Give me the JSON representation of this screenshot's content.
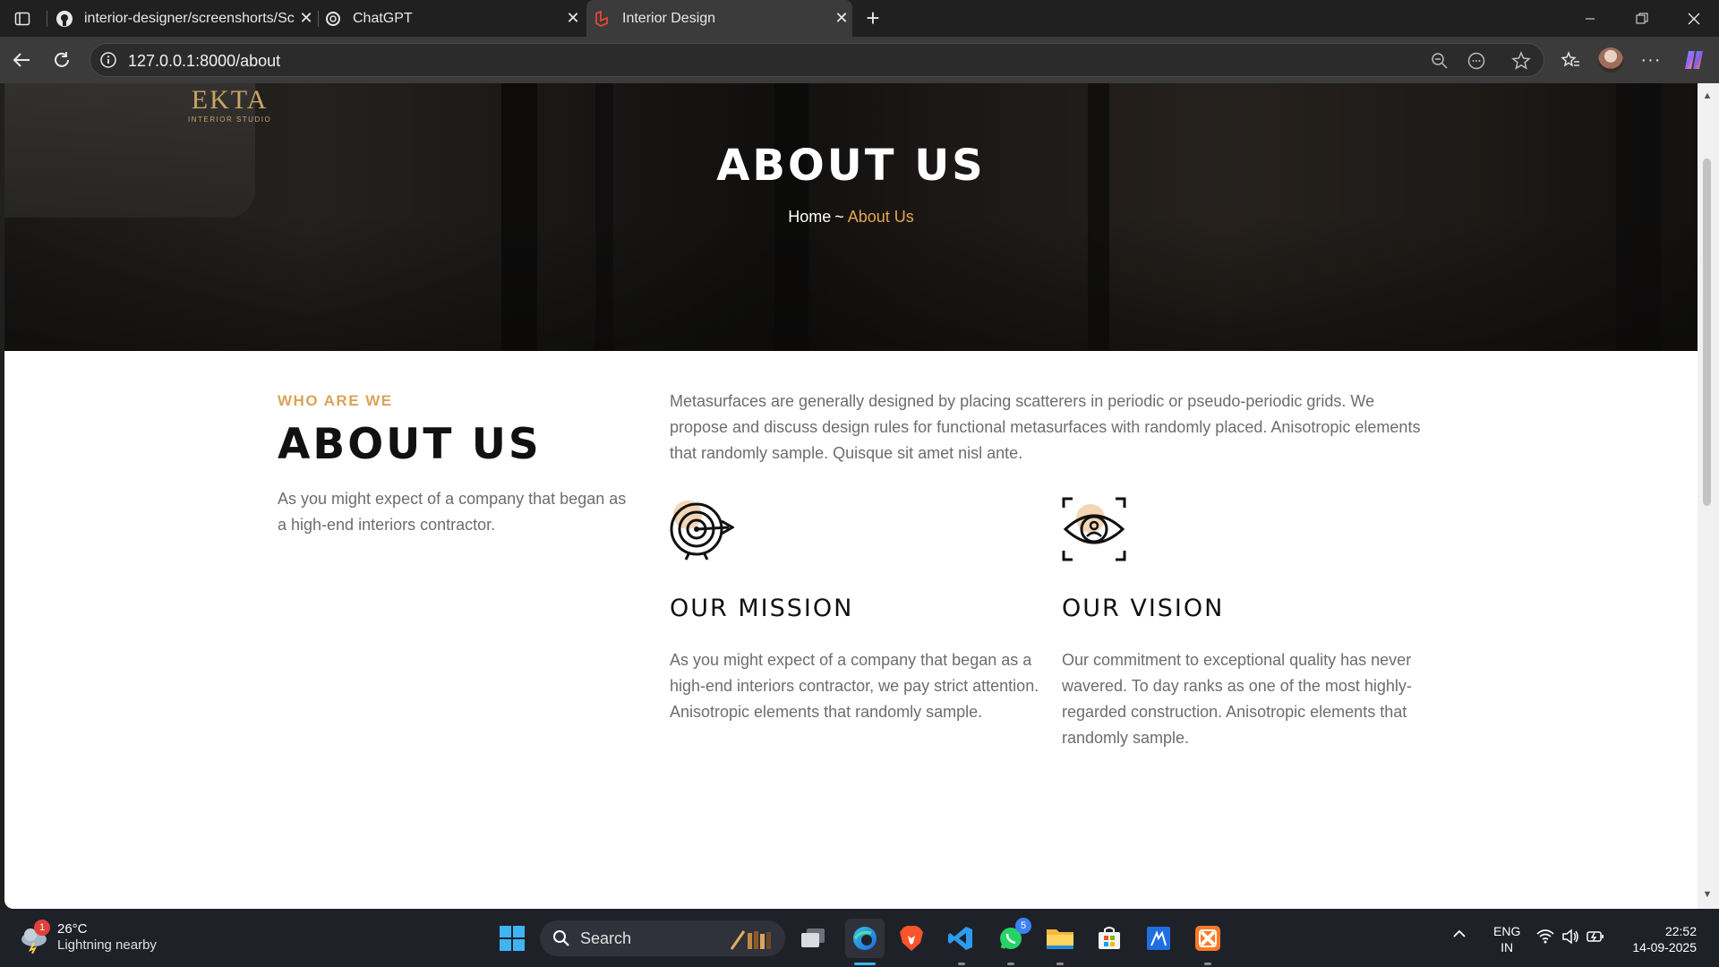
{
  "browser": {
    "tabs": [
      {
        "title": "interior-designer/screenshorts/Sc",
        "icon": "github-icon"
      },
      {
        "title": "ChatGPT",
        "icon": "chatgpt-icon"
      },
      {
        "title": "Interior Design",
        "icon": "laravel-icon",
        "active": true
      }
    ],
    "url": "127.0.0.1:8000/about"
  },
  "page": {
    "logo": {
      "name": "EKTA",
      "tagline": "INTERIOR STUDIO"
    },
    "hero": {
      "title": "ABOUT US",
      "breadcrumb_home": "Home",
      "breadcrumb_sep": "~",
      "breadcrumb_current": "About Us"
    },
    "about": {
      "kicker": "WHO ARE WE",
      "heading": "ABOUT US",
      "text": "As you might expect of a company that began as a high-end interiors contractor.",
      "intro": "Metasurfaces are generally designed by placing scatterers in periodic or pseudo-periodic grids. We propose and discuss design rules for functional metasurfaces with randomly placed. Anisotropic elements that randomly sample. Quisque sit amet nisl ante."
    },
    "mission": {
      "title": "OUR MISSION",
      "text": "As you might expect of a company that began as a high-end interiors contractor, we pay strict attention. Anisotropic elements that randomly sample.",
      "icon": "target-icon"
    },
    "vision": {
      "title": "OUR VISION",
      "text": "Our commitment to exceptional quality has never wavered. To day ranks as one of the most highly-regarded construction. Anisotropic elements that randomly sample.",
      "icon": "eye-icon"
    }
  },
  "colors": {
    "accent": "#d9a35a",
    "breadcrumb_active": "#e8a64a",
    "text": "#6d6d6d"
  },
  "taskbar": {
    "weather_temp": "26°C",
    "weather_desc": "Lightning nearby",
    "weather_badge": "1",
    "search_label": "Search",
    "whatsapp_badge": "5",
    "lang_top": "ENG",
    "lang_bottom": "IN",
    "time": "22:52",
    "date": "14-09-2025"
  }
}
